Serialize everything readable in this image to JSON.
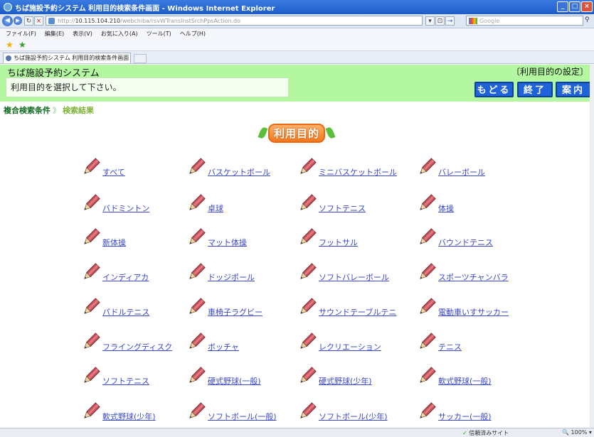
{
  "browser": {
    "title": "ちば施設予約システム 利用目的検索条件画面 - Windows Internet Explorer",
    "url_prefix": "http://",
    "url_host": "10.115.104.210",
    "url_path": "/webchiba/rsvWTransInstSrchPpsAction.do",
    "search_placeholder": "Google",
    "menu": [
      "ファイル(F)",
      "編集(E)",
      "表示(V)",
      "お気に入り(A)",
      "ツール(T)",
      "ヘルプ(H)"
    ],
    "tab_title": "ちば施設予約システム 利用目的検索条件画面",
    "status_trust": "信頼済みサイト",
    "zoom": "100%"
  },
  "header": {
    "system_title": "ちば施設予約システム",
    "page_label": "〔利用目的の設定〕",
    "instruction": "利用目的を選択して下さい。",
    "buttons": {
      "back": "もどる",
      "end": "終了",
      "guide": "案内"
    }
  },
  "breadcrumb": {
    "step1": "複合検索条件",
    "separator": "》",
    "step2": "検索結果"
  },
  "heading": "利用目的",
  "purposes": [
    "すべて",
    "バスケットボール",
    "ミニバスケットボール",
    "バレーボール",
    "バドミントン",
    "卓球",
    "ソフトテニス",
    "体操",
    "新体操",
    "マット体操",
    "フットサル",
    "バウンドテニス",
    "インディアカ",
    "ドッジボール",
    "ソフトバレーボール",
    "スポーツチャンバラ",
    "パドルテニス",
    "車椅子ラグビー",
    "サウンドテーブルテニ",
    "電動車いすサッカー",
    "フライングディスク",
    "ボッチャ",
    "レクリエーション",
    "テニス",
    "ソフトテニス",
    "硬式野球(一般)",
    "硬式野球(少年)",
    "軟式野球(一般)",
    "軟式野球(少年)",
    "ソフトボール(一般)",
    "ソフトボール(少年)",
    "サッカー(一般)"
  ],
  "colors": {
    "header_bg": "#b3f7a0",
    "button_bg": "#1e63d9",
    "link": "#3a48c8",
    "heading_orange": "#f0781d"
  }
}
